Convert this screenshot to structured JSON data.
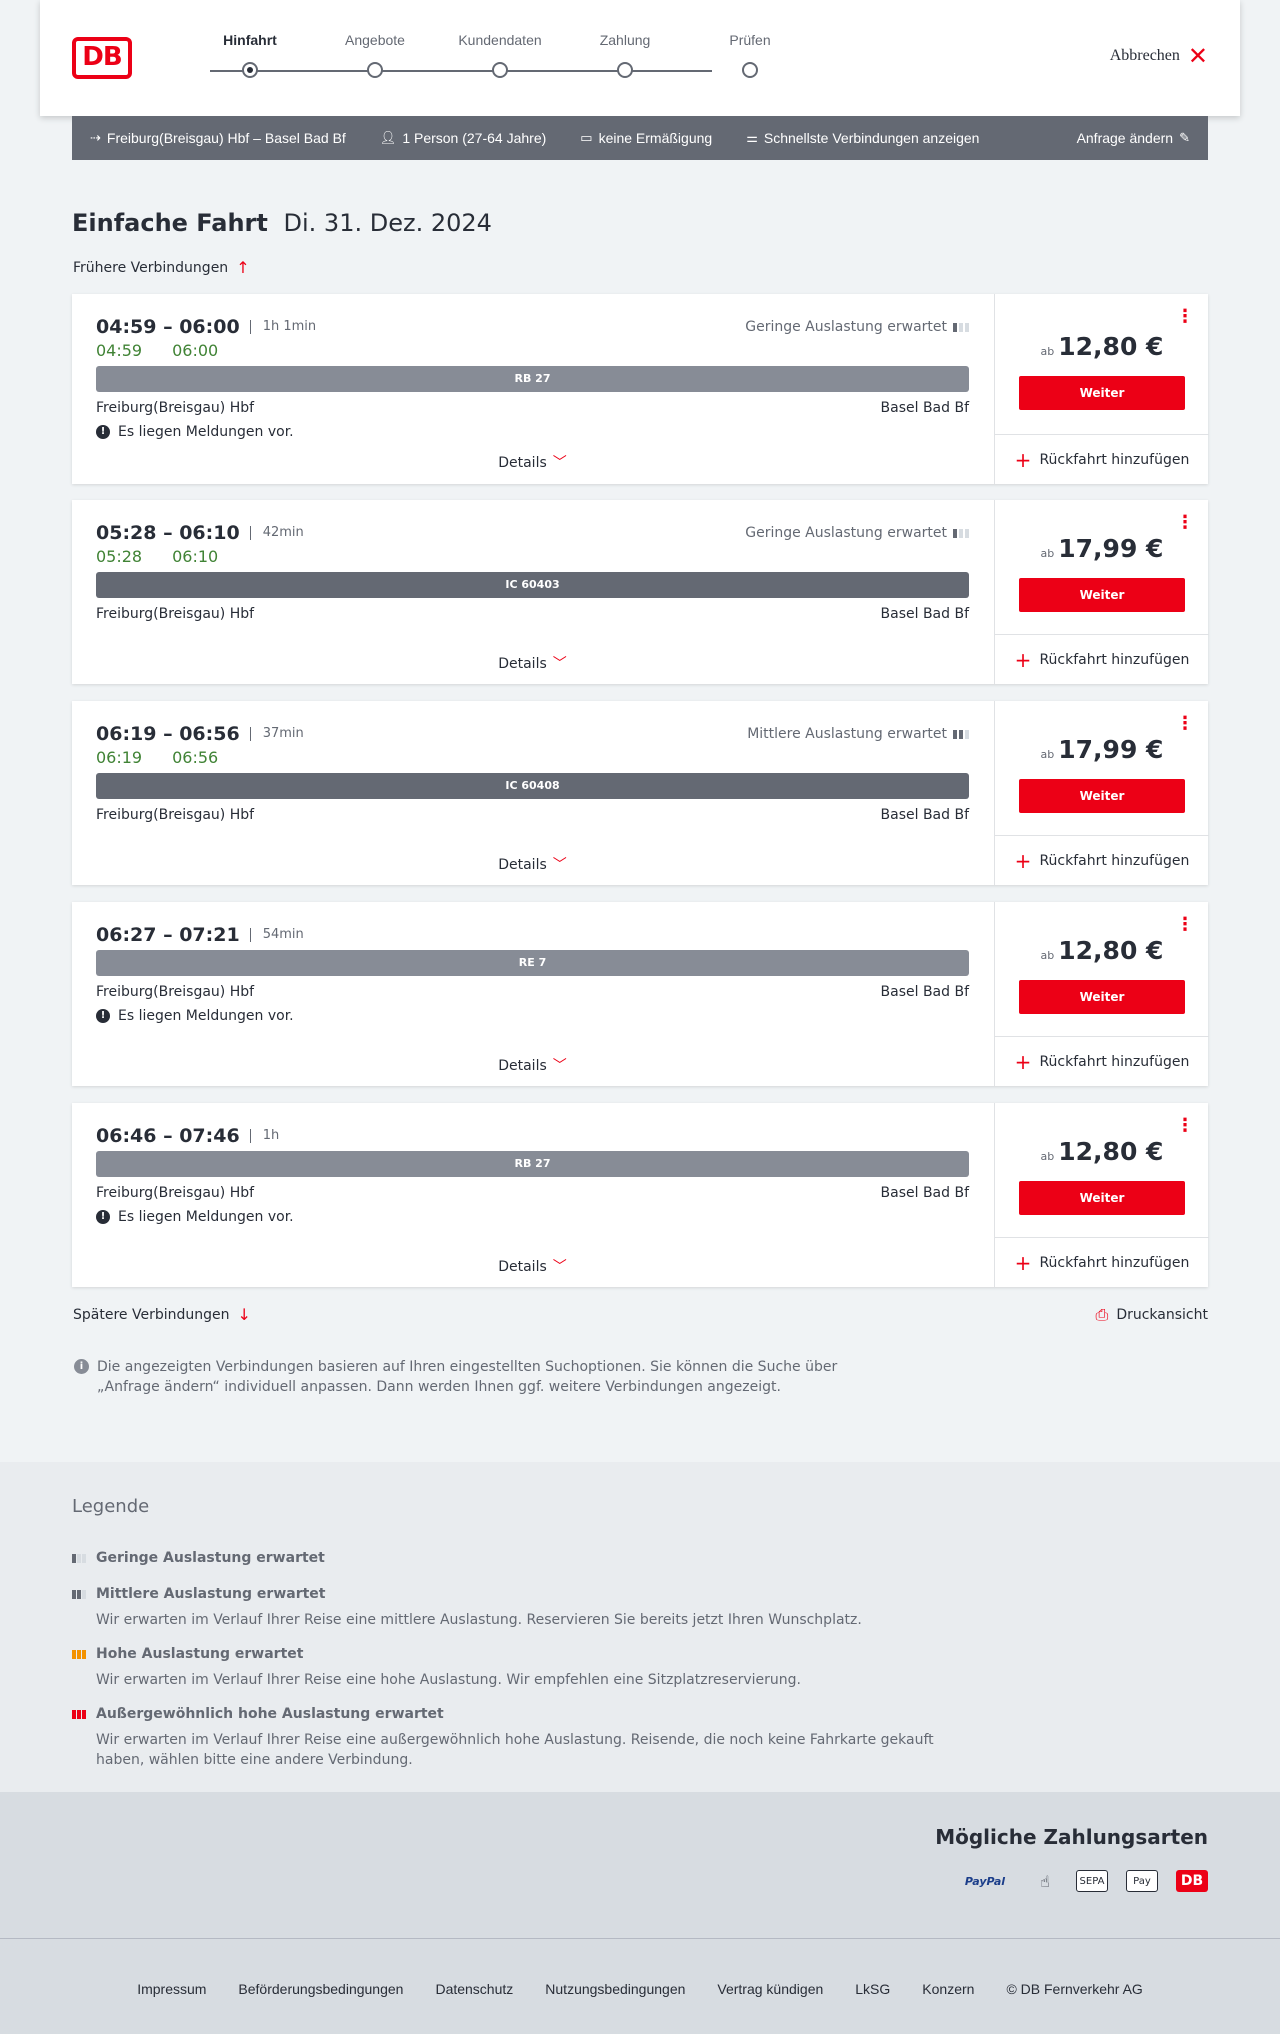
{
  "header": {
    "logo": "DB",
    "steps": [
      {
        "label": "Hinfahrt",
        "active": true
      },
      {
        "label": "Angebote",
        "active": false
      },
      {
        "label": "Kundendaten",
        "active": false
      },
      {
        "label": "Zahlung",
        "active": false
      },
      {
        "label": "Prüfen",
        "active": false
      }
    ],
    "cancel_label": "Abbrechen"
  },
  "searchbar": {
    "route": "Freiburg(Breisgau) Hbf – Basel Bad Bf",
    "persons": "1 Person (27-64 Jahre)",
    "discount": "keine Ermäßigung",
    "fastest": "Schnellste Verbindungen anzeigen",
    "edit": "Anfrage ändern"
  },
  "headline": {
    "title": "Einfache Fahrt",
    "date": "Di. 31. Dez. 2024"
  },
  "earlier_label": "Frühere Verbindungen",
  "later_label": "Spätere Verbindungen",
  "print_label": "Druckansicht",
  "common": {
    "details": "Details",
    "continue": "Weiter",
    "return": "Rückfahrt hinzufügen",
    "ab": "ab",
    "from_station": "Freiburg(Breisgau) Hbf",
    "to_station": "Basel Bad Bf"
  },
  "connections": [
    {
      "times": "04:59 – 06:00",
      "duration": "1h 1min",
      "rt_dep": "04:59",
      "rt_arr": "06:00",
      "occupancy": "Geringe Auslastung erwartet",
      "occ_level": 1,
      "train": "RB 27",
      "train_type": "regio",
      "message": "Es liegen Meldungen vor.",
      "price": "12,80 €"
    },
    {
      "times": "05:28 – 06:10",
      "duration": "42min",
      "rt_dep": "05:28",
      "rt_arr": "06:10",
      "occupancy": "Geringe Auslastung erwartet",
      "occ_level": 1,
      "train": "IC 60403",
      "train_type": "ic",
      "message": "",
      "price": "17,99 €"
    },
    {
      "times": "06:19 – 06:56",
      "duration": "37min",
      "rt_dep": "06:19",
      "rt_arr": "06:56",
      "occupancy": "Mittlere Auslastung erwartet",
      "occ_level": 2,
      "train": "IC 60408",
      "train_type": "ic",
      "message": "",
      "price": "17,99 €"
    },
    {
      "times": "06:27 – 07:21",
      "duration": "54min",
      "rt_dep": "",
      "rt_arr": "",
      "occupancy": "",
      "occ_level": 0,
      "train": "RE 7",
      "train_type": "regio",
      "message": "Es liegen Meldungen vor.",
      "price": "12,80 €"
    },
    {
      "times": "06:46 – 07:46",
      "duration": "1h",
      "rt_dep": "",
      "rt_arr": "",
      "occupancy": "",
      "occ_level": 0,
      "train": "RB 27",
      "train_type": "regio",
      "message": "Es liegen Meldungen vor.",
      "price": "12,80 €"
    }
  ],
  "note": "Die angezeigten Verbindungen basieren auf Ihren eingestellten Suchoptionen. Sie können die Suche über „Anfrage ändern“ individuell anpassen. Dann werden Ihnen ggf. weitere Verbindungen angezeigt.",
  "legend": {
    "title": "Legende",
    "items": [
      {
        "title": "Geringe Auslastung erwartet",
        "desc": ""
      },
      {
        "title": "Mittlere Auslastung erwartet",
        "desc": "Wir erwarten im Verlauf Ihrer Reise eine mittlere Auslastung. Reservieren Sie bereits jetzt Ihren Wunschplatz."
      },
      {
        "title": "Hohe Auslastung erwartet",
        "desc": "Wir erwarten im Verlauf Ihrer Reise eine hohe Auslastung. Wir empfehlen eine Sitzplatzreservierung."
      },
      {
        "title": "Außergewöhnlich hohe Auslastung erwartet",
        "desc": "Wir erwarten im Verlauf Ihrer Reise eine außergewöhnlich hohe Auslastung. Reisende, die noch keine Fahrkarte gekauft haben, wählen bitte eine andere Verbindung."
      }
    ]
  },
  "payment": {
    "title": "Mögliche Zahlungsarten",
    "methods": [
      "PayPal",
      "SEPA",
      "Pay",
      "DB"
    ]
  },
  "footer": {
    "links": [
      "Impressum",
      "Beförderungsbedingungen",
      "Datenschutz",
      "Nutzungsbedingungen",
      "Vertrag kündigen",
      "LkSG",
      "Konzern",
      "© DB Fernverkehr AG"
    ]
  },
  "colors": {
    "brand": "#ec0016",
    "realtime": "#408335",
    "bar": "#646973"
  }
}
